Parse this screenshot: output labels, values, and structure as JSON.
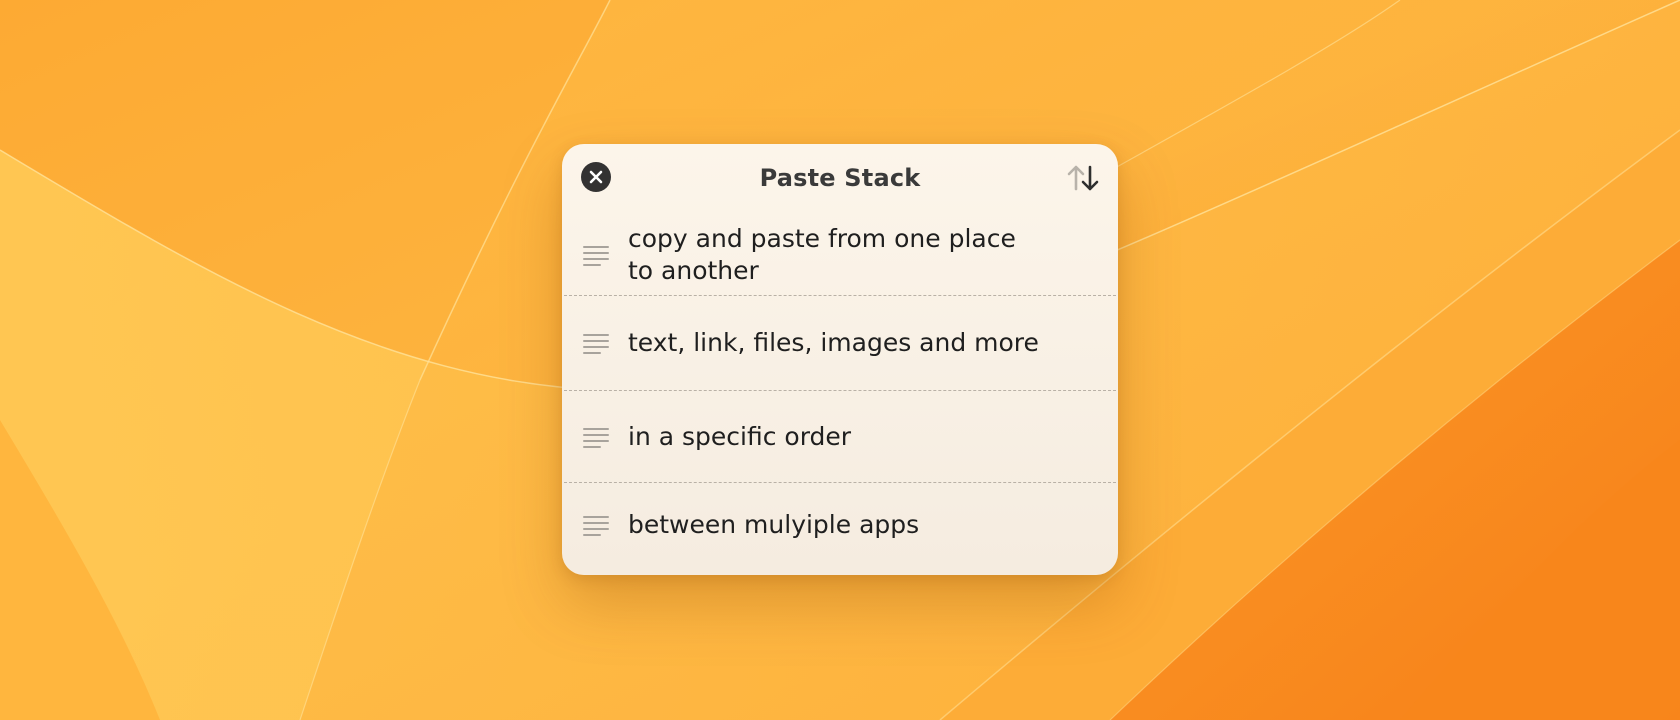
{
  "colors": {
    "wallpaper_base": "#fbaa35",
    "wallpaper_light": "#ffc552",
    "wallpaper_dark": "#f98a1e",
    "panel_bg": "#fcf5ea",
    "close_button": "#333232",
    "text": "#1f1f1f",
    "divider": "#b9b1a6"
  },
  "panel": {
    "title": "Paste Stack",
    "close_icon": "close-icon",
    "sort_icon": "sort-arrows-icon"
  },
  "items": [
    {
      "icon": "text-lines-icon",
      "text": "copy and paste from one place\nto another"
    },
    {
      "icon": "text-lines-icon",
      "text": "text, link, files, images and more"
    },
    {
      "icon": "text-lines-icon",
      "text": "in a specific order"
    },
    {
      "icon": "text-lines-icon",
      "text": "between mulyiple apps"
    }
  ]
}
